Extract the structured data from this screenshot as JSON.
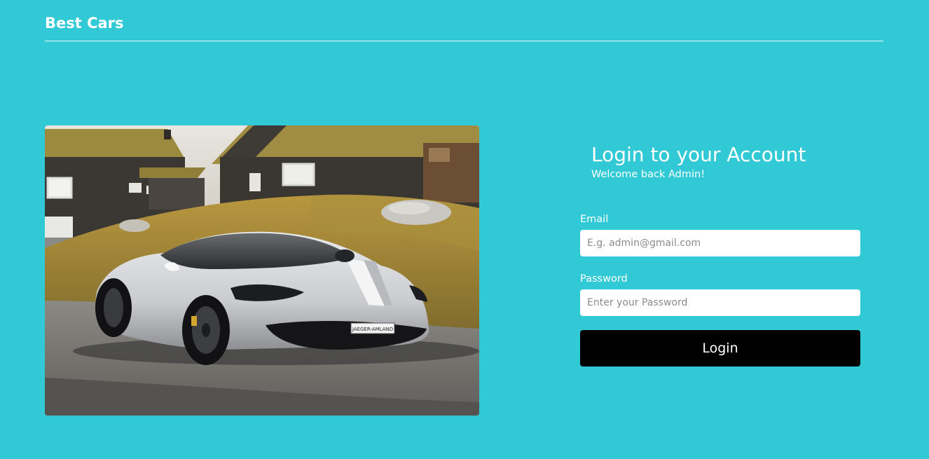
{
  "header": {
    "brand": "Best Cars"
  },
  "hero": {
    "image": "sports-car-photo",
    "plate_text": "JAEGER-AMLAND"
  },
  "login": {
    "title": "Login to your Account",
    "subtitle": "Welcome back Admin!",
    "email_label": "Email",
    "email_placeholder": "E.g. admin@gmail.com",
    "email_value": "",
    "password_label": "Password",
    "password_placeholder": "Enter your Password",
    "password_value": "",
    "button_label": "Login"
  },
  "colors": {
    "background": "#31c9d5",
    "text": "#ffffff",
    "button": "#000000",
    "input_bg": "#ffffff"
  }
}
